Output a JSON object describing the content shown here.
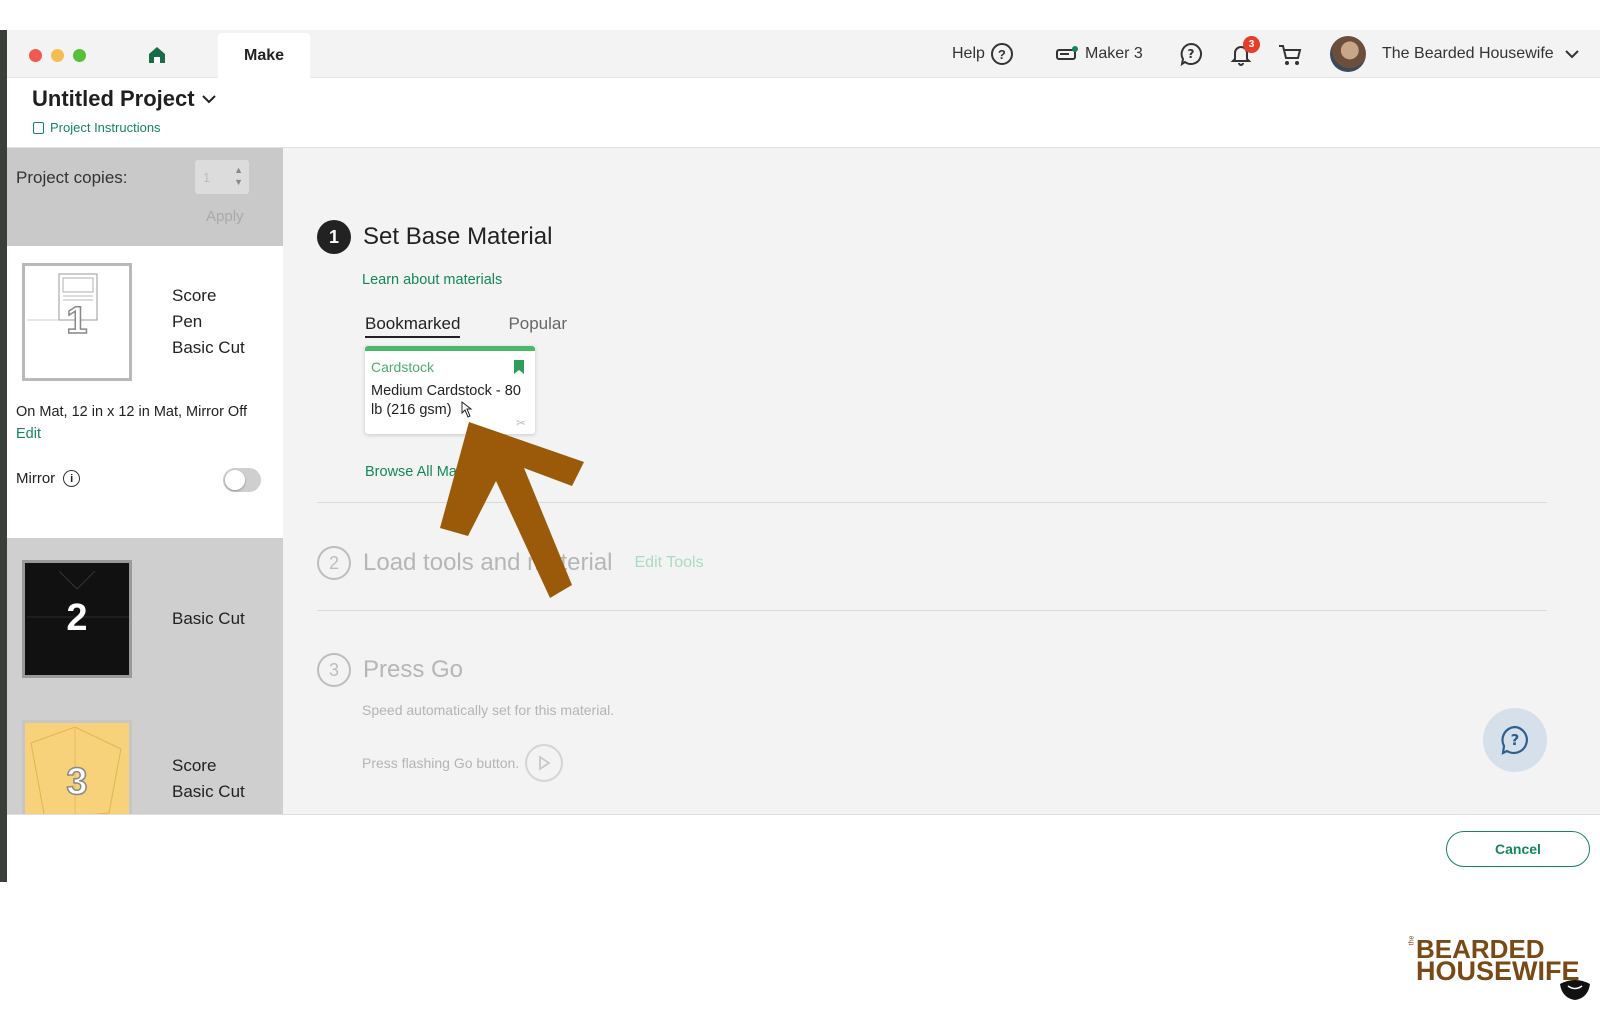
{
  "topbar": {
    "make_tab": "Make",
    "help_label": "Help",
    "machine_label": "Maker 3",
    "notification_count": "3",
    "user_name": "The Bearded Housewife"
  },
  "project": {
    "title": "Untitled Project",
    "instructions_link": "Project Instructions"
  },
  "left_panel": {
    "copies_label": "Project copies:",
    "copies_value": "1",
    "apply_label": "Apply",
    "mats": [
      {
        "number": "1",
        "operations": [
          "Score",
          "Pen",
          "Basic Cut"
        ]
      },
      {
        "number": "2",
        "operations": [
          "Basic Cut"
        ]
      },
      {
        "number": "3",
        "operations": [
          "Score",
          "Basic Cut"
        ]
      }
    ],
    "mat_description": "On Mat, 12 in x 12 in Mat, Mirror Off",
    "edit_label": "Edit",
    "mirror_label": "Mirror",
    "mirror_on": false
  },
  "steps": [
    {
      "number": "1",
      "title": "Set Base Material"
    },
    {
      "number": "2",
      "title": "Load tools and material",
      "action": "Edit Tools"
    },
    {
      "number": "3",
      "title": "Press Go",
      "sub1": "Speed automatically set for this material.",
      "sub2": "Press flashing Go button."
    }
  ],
  "material": {
    "learn_link": "Learn about materials",
    "tab_bookmarked": "Bookmarked",
    "tab_popular": "Popular",
    "card_category": "Cardstock",
    "card_name": "Medium Cardstock - 80 lb (216 gsm)",
    "browse_link": "Browse All Materials"
  },
  "bottom": {
    "cancel_label": "Cancel"
  },
  "logo": {
    "small": "the",
    "line1": "BEARDED",
    "line2": "HOUSEWIFE"
  },
  "colors": {
    "accent_green": "#14875a",
    "card_green": "#49b86b",
    "arrow_brown": "#9a5a0a",
    "logo_brown": "#7a4a16",
    "badge_red": "#e53f2c"
  }
}
